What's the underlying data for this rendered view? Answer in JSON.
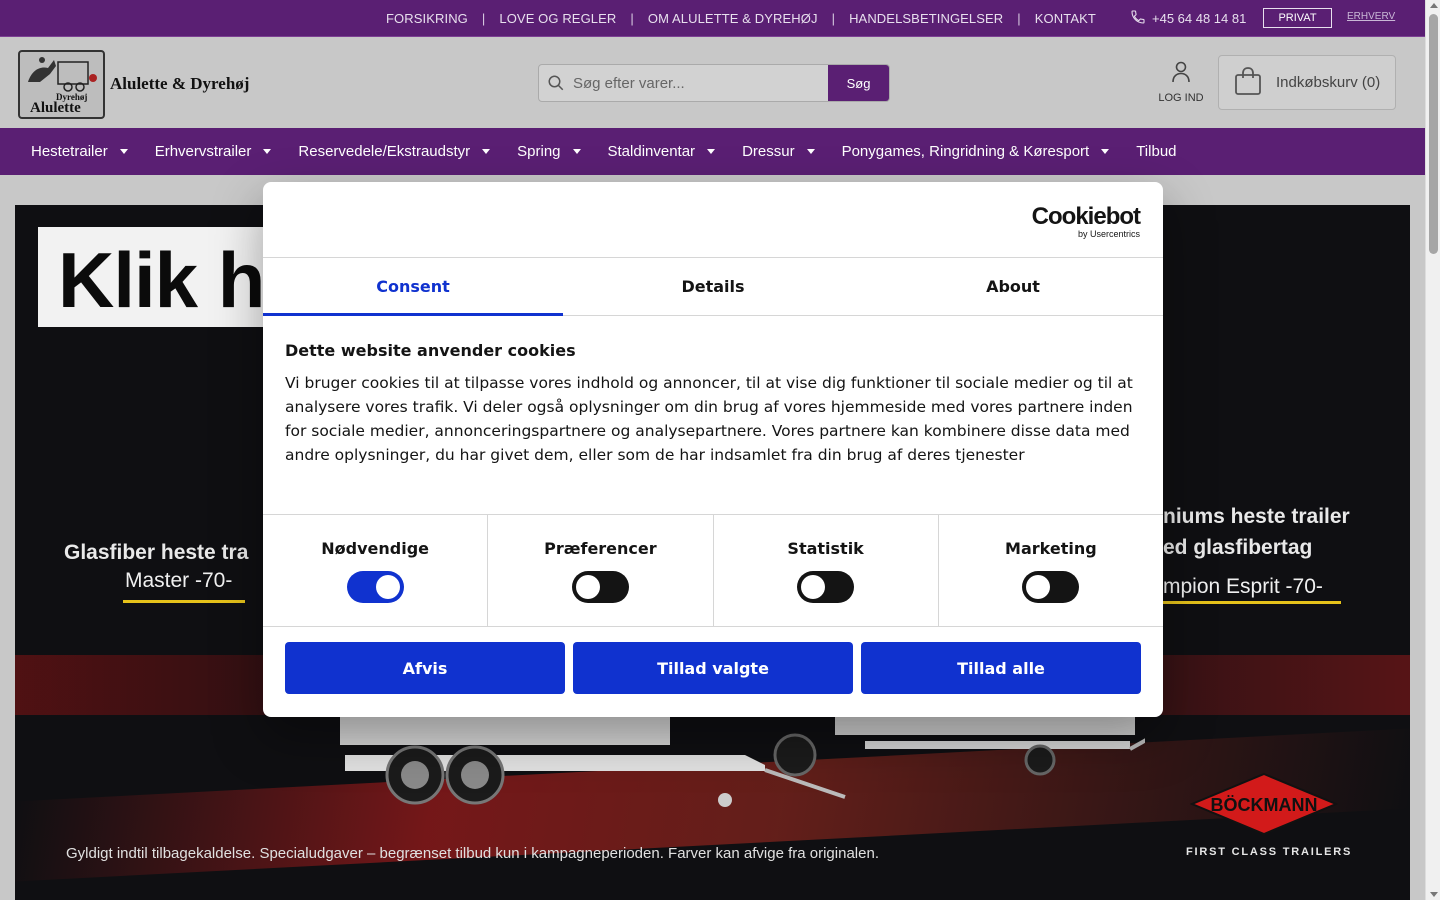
{
  "topbar": {
    "links": [
      "FORSIKRING",
      "LOVE OG REGLER",
      "OM ALULETTE & DYREHØJ",
      "HANDELSBETINGELSER",
      "KONTAKT"
    ],
    "separator": "|",
    "phone": "+45 64 48 14 81",
    "privat": "PRIVAT",
    "erhverv": "ERHVERV"
  },
  "header": {
    "logo_text_small": "Dyrehøj",
    "logo_text_large": "Alulette",
    "brand_name": "Alulette & Dyrehøj",
    "search_placeholder": "Søg efter varer...",
    "search_button": "Søg",
    "login_label": "LOG IND",
    "cart_label": "Indkøbskurv (0)"
  },
  "nav": {
    "items": [
      {
        "label": "Hestetrailer",
        "caret": true
      },
      {
        "label": "Erhvervstrailer",
        "caret": true
      },
      {
        "label": "Reservedele/Ekstraudstyr",
        "caret": true
      },
      {
        "label": "Spring",
        "caret": true
      },
      {
        "label": "Staldinventar",
        "caret": true
      },
      {
        "label": "Dressur",
        "caret": true
      },
      {
        "label": "Ponygames, Ringridning & Køresport",
        "caret": true
      },
      {
        "label": "Tilbud",
        "caret": false
      }
    ]
  },
  "hero": {
    "klik_text": "Klik h",
    "left_title": "Glasfiber heste tra",
    "left_model": "Master -70-",
    "right_title_1": "niums heste trailer",
    "right_title_2": "ed glasfibertag",
    "right_model": "mpion Esprit -70-",
    "disclaimer": "Gyldigt indtil tilbagekaldelse. Specialudgaver – begrænset tilbud kun i kampagneperioden. Farver kan afvige fra originalen.",
    "brand_logo": "BÖCKMANN",
    "brand_sub": "FIRST CLASS TRAILERS"
  },
  "cookie_dialog": {
    "logo_name": "Cookiebot",
    "logo_sub": "by Usercentrics",
    "tabs": [
      {
        "label": "Consent",
        "active": true
      },
      {
        "label": "Details",
        "active": false
      },
      {
        "label": "About",
        "active": false
      }
    ],
    "heading": "Dette website anvender cookies",
    "body": "Vi bruger cookies til at tilpasse vores indhold og annoncer, til at vise dig funktioner til sociale medier og til at analysere vores trafik. Vi deler også oplysninger om din brug af vores hjemmeside med vores partnere inden for sociale medier, annonceringspartnere og analysepartnere. Vores partnere kan kombinere disse data med andre oplysninger, du har givet dem, eller som de har indsamlet fra din brug af deres tjenester",
    "categories": [
      {
        "label": "Nødvendige",
        "enabled": true
      },
      {
        "label": "Præferencer",
        "enabled": false
      },
      {
        "label": "Statistik",
        "enabled": false
      },
      {
        "label": "Marketing",
        "enabled": false
      }
    ],
    "buttons": {
      "deny": "Afvis",
      "allow_selected": "Tillad valgte",
      "allow_all": "Tillad alle"
    }
  },
  "colors": {
    "brand_purple": "#5a1f73",
    "cookie_blue": "#1032cf",
    "accent_yellow": "#e6c21a"
  }
}
